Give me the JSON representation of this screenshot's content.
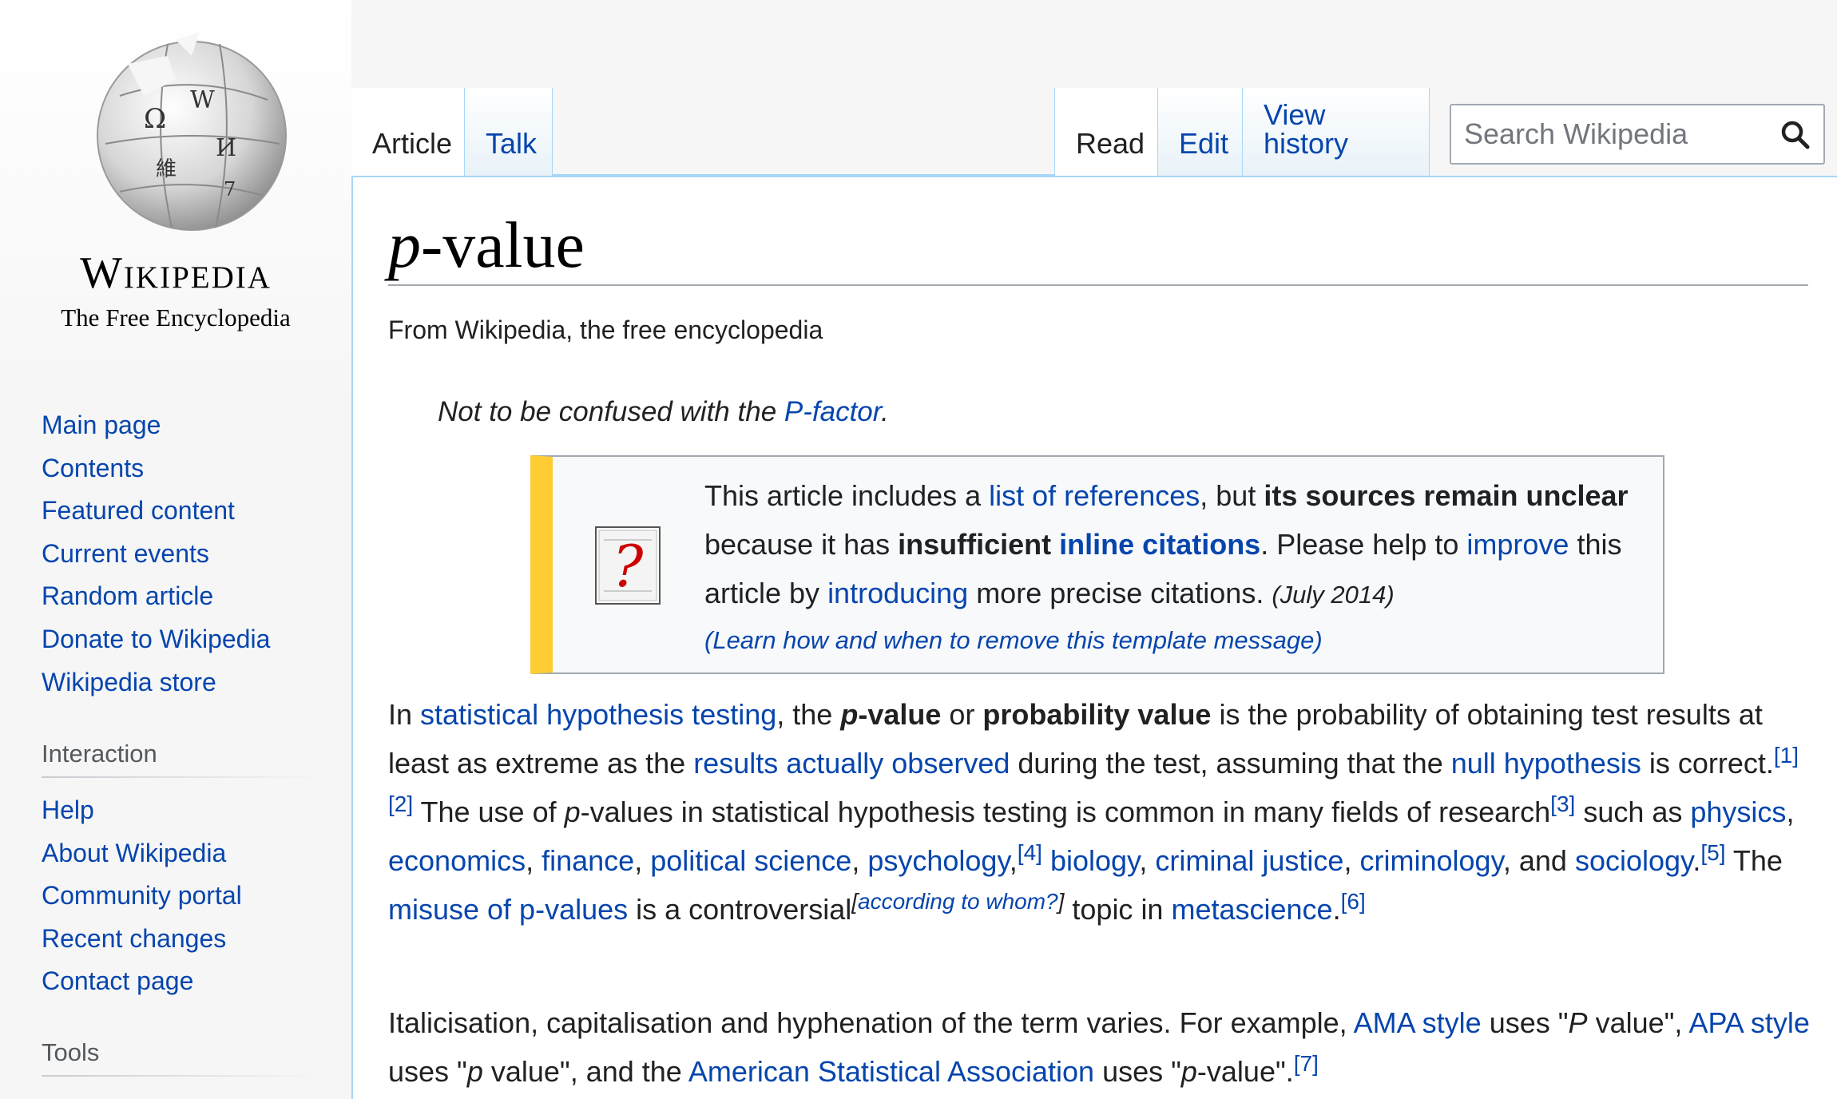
{
  "sidebar": {
    "wordmark": "Wikipedia",
    "tagline": "The Free Encyclopedia",
    "main_nav": [
      "Main page",
      "Contents",
      "Featured content",
      "Current events",
      "Random article",
      "Donate to Wikipedia",
      "Wikipedia store"
    ],
    "interaction_heading": "Interaction",
    "interaction_nav": [
      "Help",
      "About Wikipedia",
      "Community portal",
      "Recent changes",
      "Contact page"
    ],
    "tools_heading": "Tools"
  },
  "tabs": {
    "article": "Article",
    "talk": "Talk",
    "read": "Read",
    "edit": "Edit",
    "view_history": "View history"
  },
  "search": {
    "placeholder": "Search Wikipedia"
  },
  "title": {
    "italic": "p",
    "rest": "-value"
  },
  "site_sub": "From Wikipedia, the free encyclopedia",
  "hatnote": {
    "prefix": "Not to be confused with the ",
    "link": "P-factor",
    "suffix": "."
  },
  "ambox": {
    "t1": "This article includes a ",
    "link1": "list of references",
    "t2": ", but ",
    "b1": "its sources remain unclear",
    "t3": " because it has ",
    "b2": "insufficient ",
    "link2": "inline citations",
    "t4": ". Please help to ",
    "link3": "improve",
    "t5": " this article by ",
    "link4": "introducing",
    "t6": " more precise citations. ",
    "date": "(July 2014)",
    "learn": "(Learn how and when to remove this template message)"
  },
  "para1": {
    "s1": "In ",
    "l_sht": "statistical hypothesis testing",
    "s2": ", the ",
    "b_p": "p",
    "b_value": "-value",
    "s3": " or ",
    "b_prob": "probability value",
    "s4": " is the probability of obtaining test results at least as extreme as the ",
    "l_obs": "results actually observed",
    "s5": " during the test, assuming that the ",
    "l_null": "null hypothesis",
    "s6": " is correct.",
    "ref1": "[1]",
    "ref2": "[2]",
    "s7": " The use of ",
    "i_p": "p",
    "s8": "-values in statistical hypothesis testing is common in many fields of research",
    "ref3": "[3]",
    "s9": " such as ",
    "l_physics": "physics",
    "c1": ", ",
    "l_econ": "economics",
    "c2": ", ",
    "l_fin": "finance",
    "c3": ", ",
    "l_pol": "political science",
    "c4": ", ",
    "l_psy": "psychology",
    "c5": ",",
    "ref4": "[4]",
    "c6": " ",
    "l_bio": "biology",
    "c7": ", ",
    "l_cj": "criminal justice",
    "c8": ", ",
    "l_crim": "criminology",
    "c9": ", and ",
    "l_soc": "sociology",
    "c10": ".",
    "ref5": "[5]",
    "s10": " The ",
    "l_misuse": "misuse of p-values",
    "s11": " is a controversial",
    "note_open": "[",
    "note": "according to whom?",
    "note_close": "]",
    "s12": " topic in ",
    "l_meta": "metascience",
    "c11": ".",
    "ref6": "[6]"
  },
  "para2": {
    "s1": "Italicisation, capitalisation and hyphenation of the term varies. For example, ",
    "l_ama": "AMA style",
    "s2": " uses \"",
    "i_P": "P",
    "s3": " value\", ",
    "l_apa": "APA style",
    "s4": " uses \"",
    "i_p": "p",
    "s5": " value\", and the ",
    "l_asa": "American Statistical Association",
    "s6": " uses \"",
    "i_p2": "p",
    "s7": "-value\".",
    "ref7": "[7]"
  }
}
